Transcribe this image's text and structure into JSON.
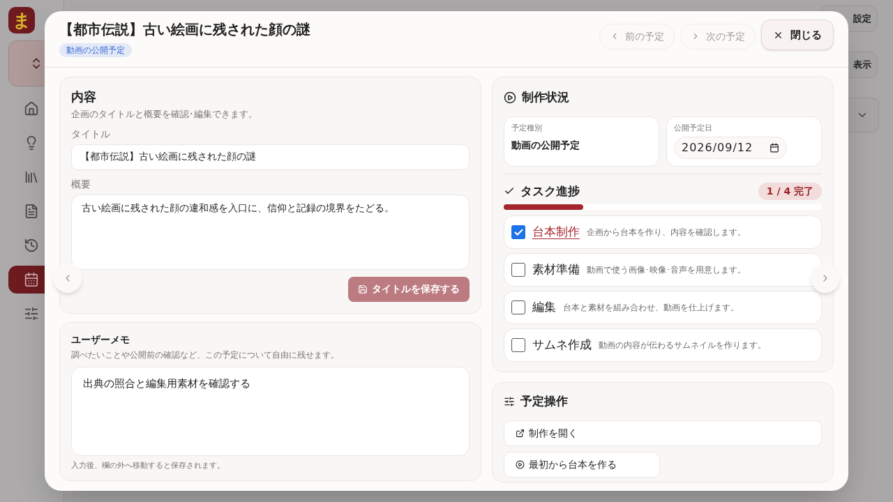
{
  "app": {
    "logo": "ま",
    "nav": [
      {
        "selected": false
      },
      {
        "selected": false
      },
      {
        "selected": false
      },
      {
        "selected": false
      },
      {
        "selected": false
      },
      {
        "selected": true
      },
      {
        "selected": false
      }
    ],
    "settings_button": "設定",
    "view_button": "表示"
  },
  "dialog": {
    "title": "【都市伝説】古い絵画に残された顔の謎",
    "badge": "動画の公開予定",
    "prev": {
      "label": "前の予定",
      "disabled": true
    },
    "next": {
      "label": "次の予定",
      "disabled": true
    },
    "close": "閉じる",
    "content": {
      "heading": "内容",
      "description": "企画のタイトルと概要を確認･編集できます。",
      "title_label": "タイトル",
      "title_value": "【都市伝説】古い絵画に残された顔の謎",
      "summary_label": "概要",
      "summary_value": "古い絵画に残された顔の違和感を入口に、信仰と記録の境界をたどる。",
      "save_button": {
        "label": "タイトルを保存する",
        "disabled": true
      }
    },
    "memo": {
      "heading": "ユーザーメモ",
      "description": "調べたいことや公開前の確認など、この予定について自由に残せます。",
      "value": "出典の照合と編集用素材を確認する",
      "hint": "入力後、欄の外へ移動すると保存されます。"
    },
    "status": {
      "heading": "制作状況",
      "type_label": "予定種別",
      "type_value": "動画の公開予定",
      "date_label": "公開予定日",
      "date_value": "2026/09/12"
    },
    "progress": {
      "heading": "タスク進捗",
      "count": "1 / 4 完了",
      "level": 0.25
    },
    "tasks": [
      {
        "name": "台本制作",
        "description": "企画から台本を作り、内容を確認します。",
        "checked": true
      },
      {
        "name": "素材準備",
        "description": "動画で使う画像･映像･音声を用意します。",
        "checked": false
      },
      {
        "name": "編集",
        "description": "台本と素材を組み合わせ、動画を仕上げます。",
        "checked": false
      },
      {
        "name": "サムネ作成",
        "description": "動画の内容が伝わるサムネイルを作ります。",
        "checked": false
      }
    ],
    "actions": {
      "heading": "予定操作",
      "buttons": [
        {
          "label": "制作を開く",
          "kind": "link"
        },
        {
          "label": "最初から台本を作る",
          "kind": "play"
        }
      ]
    }
  }
}
